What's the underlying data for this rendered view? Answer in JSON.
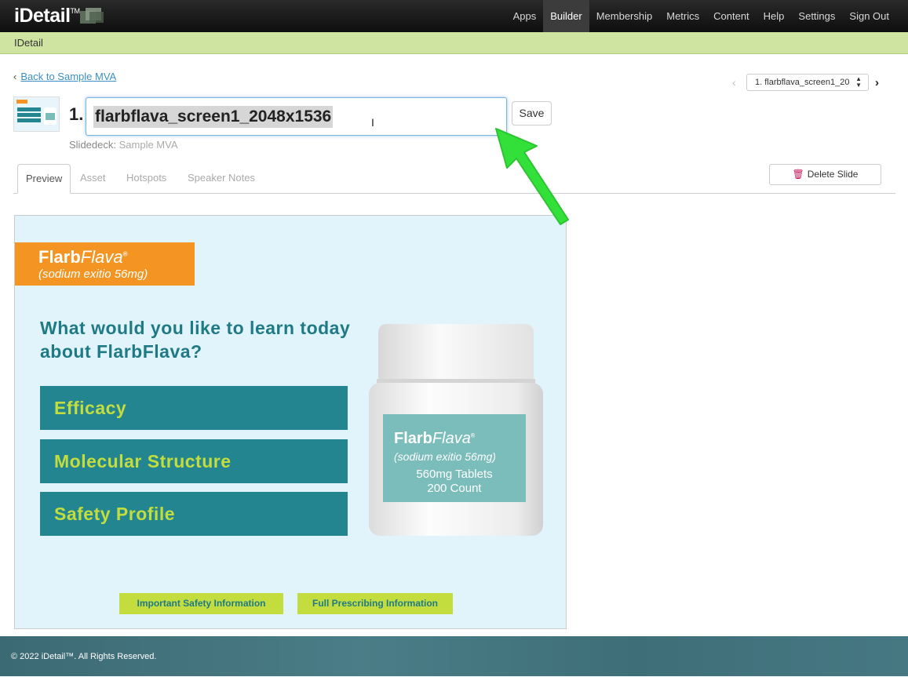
{
  "topnav": {
    "brand": "iDetail",
    "brand_tm": "TM",
    "items": [
      "Apps",
      "Builder",
      "Membership",
      "Metrics",
      "Content",
      "Help",
      "Settings",
      "Sign Out"
    ],
    "active_item": "Builder"
  },
  "subbar": {
    "label": "IDetail"
  },
  "header": {
    "back_link": "Back to Sample MVA",
    "slide_number": "1.",
    "title_value": "flarbflava_screen1_2048x1536",
    "save_label": "Save",
    "slidedeck_label": "Slidedeck:",
    "slidedeck_value": "Sample MVA",
    "pager_selected": "1. flarbflava_screen1_20"
  },
  "tabs": [
    "Preview",
    "Asset",
    "Hotspots",
    "Speaker Notes"
  ],
  "active_tab": "Preview",
  "delete_label": "Delete Slide",
  "slide": {
    "brand_strong": "Flarb",
    "brand_light": "Flava",
    "brand_reg": "®",
    "brand_sub": "(sodium exitio 56mg)",
    "question": "What would you like to learn today about FlarbFlava?",
    "options": [
      "Efficacy",
      "Molecular Structure",
      "Safety Profile"
    ],
    "bottle_line1": "560mg Tablets",
    "bottle_line2": "200 Count",
    "footer_buttons": [
      "Important Safety Information",
      "Full Prescribing Information"
    ],
    "colors": {
      "orange": "#f39423",
      "teal": "#22858f",
      "lime": "#c3dd3e",
      "bg": "#e1f4fb"
    }
  },
  "footer": {
    "copyright": "© 2022 iDetail™.  All Rights Reserved."
  }
}
